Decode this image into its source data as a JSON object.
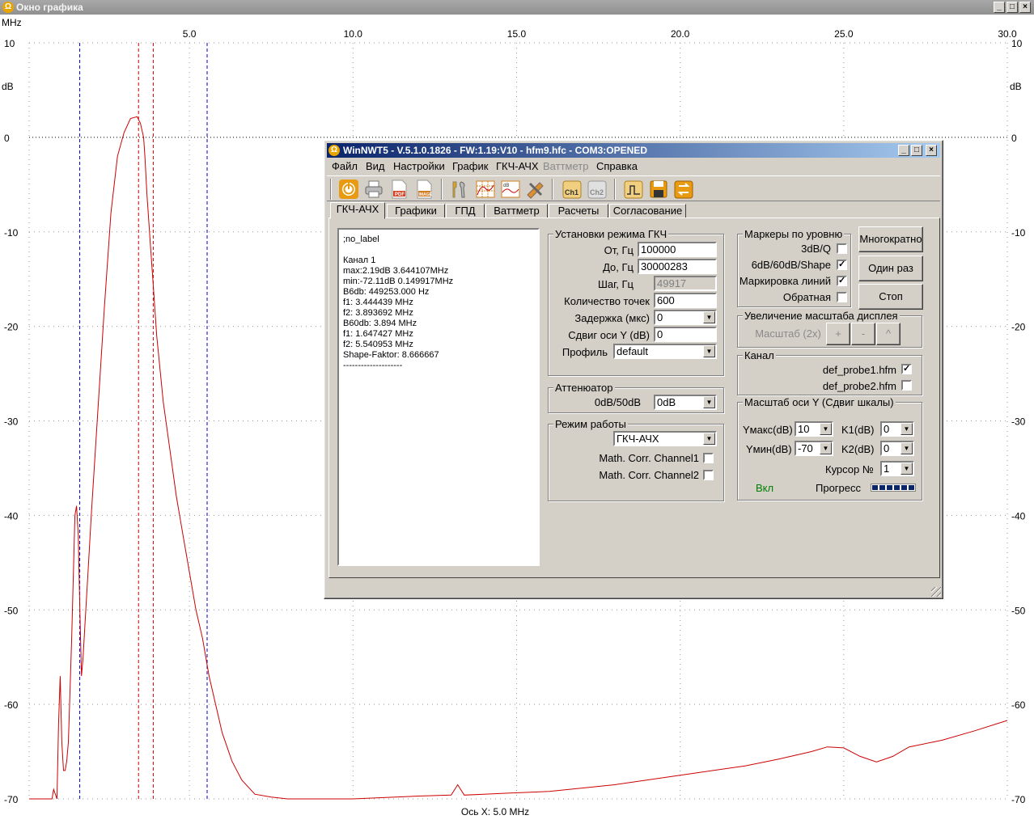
{
  "outer_window": {
    "title": "Окно графика",
    "buttons": [
      "_",
      "□",
      "×"
    ]
  },
  "plot": {
    "x_unit": "MHz",
    "y_unit": "dB",
    "x_ticks": [
      "5.0",
      "10.0",
      "15.0",
      "20.0",
      "25.0",
      "30.0"
    ],
    "y_ticks": [
      "10",
      "0",
      "-10",
      "-20",
      "-30",
      "-40",
      "-50",
      "-60",
      "-70"
    ],
    "x_axis_caption": "Ось X: 5.0 MHz",
    "colors": {
      "trace": "#cc0000",
      "blue_markers": "#0000cc",
      "red_markers": "#cc0000",
      "grid": "#9a9a9a"
    }
  },
  "chart_data": {
    "type": "line",
    "title": "",
    "xlabel": "MHz",
    "ylabel": "dB",
    "xlim": [
      0.1,
      30.0
    ],
    "ylim": [
      -70,
      10
    ],
    "grid": true,
    "series": [
      {
        "x": [
          0.1,
          0.8,
          0.85,
          0.95,
          1.0,
          1.05,
          1.1,
          1.15,
          1.2,
          1.25,
          1.3,
          1.4,
          1.5,
          1.55,
          1.6,
          1.65,
          1.7,
          1.75,
          1.8,
          1.9,
          2.0,
          2.2,
          2.4,
          2.6,
          2.8,
          3.0,
          3.2,
          3.4,
          3.5,
          3.6,
          3.64,
          3.7,
          3.8,
          3.9,
          4.0,
          4.2,
          4.4,
          4.6,
          4.8,
          5.0,
          5.2,
          5.4,
          5.6,
          5.8,
          6.0,
          6.3,
          6.6,
          7.0,
          7.5,
          8.0,
          9.0,
          10.0,
          12.0,
          13.0,
          13.2,
          13.4,
          14.0,
          16.0,
          18.0,
          20.0,
          22.0,
          23.0,
          24.0,
          24.5,
          25.0,
          25.5,
          26.0,
          26.5,
          27.0,
          28.0,
          29.0,
          30.0
        ],
        "y": [
          -70,
          -70,
          -69,
          -70,
          -62,
          -57,
          -64,
          -67,
          -67,
          -66,
          -64,
          -53,
          -40,
          -39,
          -42,
          -50,
          -57,
          -55,
          -52,
          -46,
          -40,
          -29,
          -18,
          -8,
          -2,
          0.5,
          2.0,
          2.19,
          1.5,
          0,
          -2,
          -6,
          -11,
          -16,
          -21,
          -28,
          -33,
          -38,
          -42,
          -46,
          -50,
          -53,
          -57,
          -60,
          -63,
          -66,
          -68,
          -69.5,
          -69.8,
          -70,
          -70,
          -70,
          -69.7,
          -69.6,
          -68.5,
          -69.6,
          -69.5,
          -69.2,
          -68.5,
          -67.5,
          -66.5,
          -65.8,
          -65.0,
          -64.5,
          -64.6,
          -65.5,
          -66.1,
          -65.5,
          -64.5,
          -63.8,
          -62.8,
          -61.7
        ]
      }
    ],
    "vertical_markers": {
      "blue": [
        1.647427,
        5.540953
      ],
      "red": [
        3.444439,
        3.893692
      ]
    }
  },
  "dialog": {
    "title": "WinNWT5 - V.5.1.0.1826 - FW:1.19:V10 - hfm9.hfc - COM3:OPENED",
    "menu": [
      "Файл",
      "Вид",
      "Настройки",
      "График",
      "ГКЧ-АЧХ",
      "Ваттметр",
      "Справка"
    ],
    "toolbar_icons": [
      "power-icon",
      "printer-icon",
      "pdf-icon",
      "image-icon",
      "tools-icon",
      "grid-icon",
      "db-graph-icon",
      "calibrate-icon",
      "ch1-icon",
      "ch2-icon",
      "sweep-icon",
      "save-icon",
      "swap-icon"
    ],
    "toolbar_labels": {
      "pdf": "PDF",
      "image": "IMAGE",
      "ch1": "Ch1",
      "ch2": "Ch2",
      "db": "dB"
    },
    "tabs": [
      "ГКЧ-АЧХ",
      "Графики",
      "ГПД",
      "Ваттметр",
      "Расчеты",
      "Согласование"
    ],
    "info_lines": [
      ";no_label",
      "",
      "Канал 1",
      "max:2.19dB 3.644107MHz",
      "min:-72.11dB 0.149917MHz",
      "B6db: 449253.000 Hz",
      "f1: 3.444439 MHz",
      "f2: 3.893692 MHz",
      "B60db: 3.894 MHz",
      "f1: 1.647427 MHz",
      "f2: 5.540953 MHz",
      "Shape-Faktor: 8.666667",
      "--------------------"
    ],
    "sweep": {
      "title": "Установки режима ГКЧ",
      "from_label": "От, Гц",
      "from_value": "100000",
      "to_label": "До, Гц",
      "to_value": "30000283",
      "step_label": "Шаг, Гц",
      "step_value": "49917",
      "points_label": "Количество точек",
      "points_value": "600",
      "delay_label": "Задержка (мкс)",
      "delay_value": "0",
      "yshift_label": "Сдвиг оси Y (dB)",
      "yshift_value": "0",
      "profile_label": "Профиль",
      "profile_value": "default"
    },
    "attenuator": {
      "title": "Аттенюатор",
      "label": "0dB/50dB",
      "value": "0dB"
    },
    "mode": {
      "title": "Режим работы",
      "value": "ГКЧ-АЧХ",
      "corr1_label": "Math. Corr. Channel1",
      "corr1_checked": false,
      "corr2_label": "Math. Corr. Channel2",
      "corr2_checked": false
    },
    "markers": {
      "title": "Маркеры по уровню",
      "q_label": "3dB/Q",
      "q_checked": false,
      "shape_label": "6dB/60dB/Shape",
      "shape_checked": true,
      "lines_label": "Маркировка линий",
      "lines_checked": true,
      "reverse_label": "Обратная",
      "reverse_checked": false,
      "check_mark": "✓"
    },
    "buttons": {
      "multi": "Многократно",
      "once": "Один раз",
      "stop": "Стоп"
    },
    "zoom": {
      "title": "Увеличение масштаба дисплея",
      "label": "Масштаб (2x)",
      "plus": "+",
      "minus": "-",
      "up": "^"
    },
    "channel": {
      "title": "Канал",
      "probe1": "def_probe1.hfm",
      "probe1_checked": true,
      "probe2": "def_probe2.hfm",
      "probe2_checked": false
    },
    "yscale": {
      "title": "Масштаб оси Y (Сдвиг шкалы)",
      "ymax_label": "Yмакс(dB)",
      "ymax_value": "10",
      "ymin_label": "Yмин(dB)",
      "ymin_value": "-70",
      "k1_label": "K1(dB)",
      "k1_value": "0",
      "k2_label": "K2(dB)",
      "k2_value": "0",
      "cursor_label": "Курсор №",
      "cursor_value": "1",
      "status": "Вкл",
      "progress_label": "Прогресс",
      "progress": 1.0
    },
    "title_buttons": [
      "_",
      "□",
      "×"
    ]
  }
}
